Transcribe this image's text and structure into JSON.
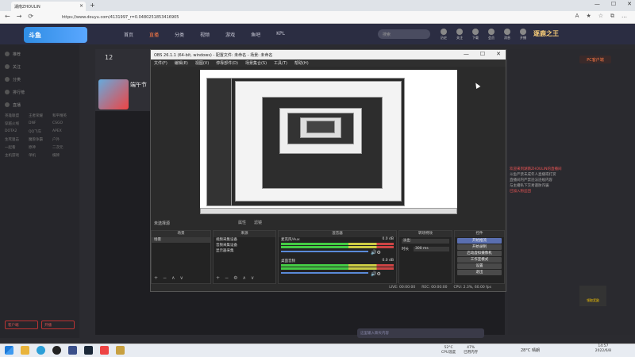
{
  "browser": {
    "tab_title": "湖南ZHOULIN",
    "url": "https://www.douyu.com/4131997_r=0.0480251853416905",
    "new_tab": "+",
    "nav": [
      "←",
      "→",
      "⟳"
    ],
    "win": [
      "—",
      "☐",
      "✕"
    ],
    "tools": [
      "A",
      "★",
      "☆",
      "⧉",
      "…"
    ]
  },
  "site": {
    "logo": "斗鱼",
    "nav_links": [
      "首页",
      "直播",
      "分类",
      "视频",
      "游戏",
      "鱼吧",
      "KPL"
    ],
    "search_placeholder": "搜索",
    "top_icons": [
      "历史",
      "关注",
      "下载",
      "会员",
      "消息",
      "开播"
    ],
    "banner": "逐鹿之王",
    "viewer_count": "12",
    "stream_title": "端午节",
    "pc_btn": "PC客户端",
    "sidebar": [
      "推荐",
      "关注",
      "分类",
      "排行榜",
      "直播"
    ],
    "sidebar_grid": [
      "英雄联盟",
      "王者荣耀",
      "和平精英",
      "穿越火线",
      "DNF",
      "CSGO",
      "DOTA2",
      "QQ飞车",
      "APEX",
      "生死狙击",
      "魔兽争霸",
      "户外",
      "一起看",
      "原神",
      "二次元",
      "主机游戏",
      "单机",
      "棋牌"
    ],
    "sidebar_buttons": [
      "客户端",
      "开播"
    ],
    "danmu": [
      {
        "t": "欢迎来到湖南ZHOULIN的直播间",
        "red": true
      },
      {
        "t": "斗鱼严禁未成年人直播或打赏",
        "red": false
      },
      {
        "t": "直播间内严禁违法违规内容",
        "red": false
      },
      {
        "t": "与主播私下交易谨防诈骗",
        "red": false
      },
      {
        "t": "已加入粉丝团",
        "red": true
      }
    ],
    "chat_placeholder": "这里输入聊天内容",
    "ad": "领取奖励"
  },
  "obs": {
    "title": "OBS 26.1.1 (64-bit, windows) - 配置文件: 未命名 - 场景: 未命名",
    "menu": [
      "文件(F)",
      "编辑(E)",
      "视图(V)",
      "停靠部件(D)",
      "场景集合(S)",
      "工具(T)",
      "帮助(H)"
    ],
    "scenes_label": "未选择源",
    "preview_buttons": [
      "属性",
      "滤镜"
    ],
    "docks": {
      "scenes": "场景",
      "sources": "来源",
      "mixer": "混音器",
      "transitions": "转场特效",
      "controls": "控件"
    },
    "scene_items": [
      "场景"
    ],
    "source_items": [
      "视频采集设备",
      "音频采集设备",
      "显示器采集"
    ],
    "mixer": [
      {
        "name": "麦克风/Aux",
        "db": "0.0 dB"
      },
      {
        "name": "桌面音频",
        "db": "0.0 dB"
      }
    ],
    "transition_type": "淡出",
    "duration_label": "时长",
    "duration": "300 ms",
    "controls": [
      "开始推流",
      "开始录制",
      "启动虚拟摄像机",
      "工作室模式",
      "设置",
      "退出"
    ],
    "status": [
      "LIVE: 00:00:00",
      "REC: 00:00:00",
      "CPU: 2.3%, 60.00 fps"
    ],
    "dock_footer": [
      "+",
      "−",
      "⚙",
      "∧",
      "∨"
    ]
  },
  "taskbar": {
    "temp_cpu": "52°C",
    "cpu_label": "CPU温度",
    "mem": "47%",
    "mem_label": "已用内存",
    "weather": "28°C 晴朗",
    "time": "14:57",
    "date": "2022/6/8"
  }
}
